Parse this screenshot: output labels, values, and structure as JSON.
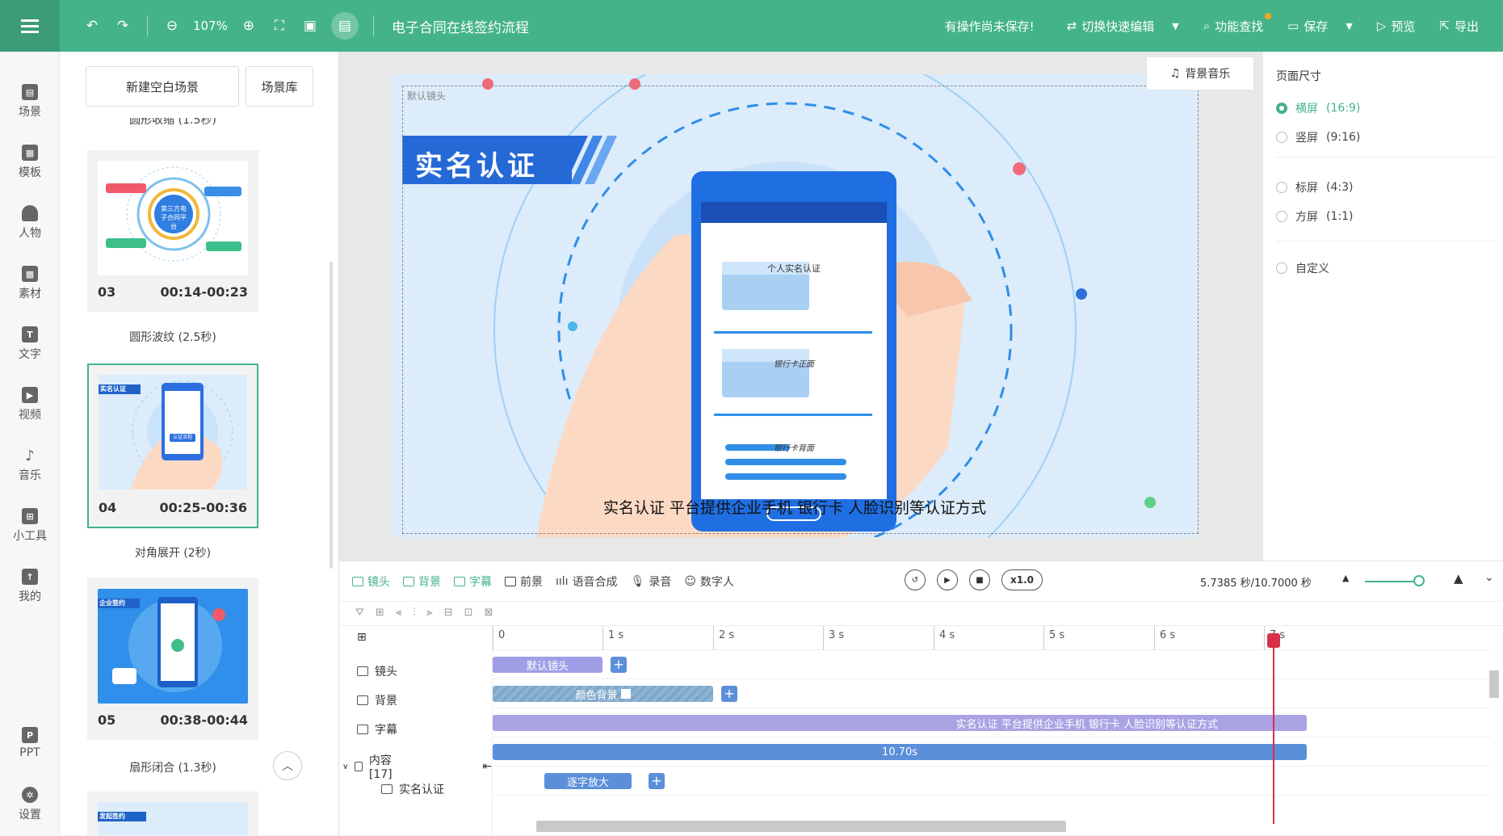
{
  "topbar": {
    "zoom": "107%",
    "doc_title": "电子合同在线签约流程",
    "unsaved": "有操作尚未保存!",
    "switch_label": "切换快速编辑",
    "find_label": "功能查找",
    "save_label": "保存",
    "preview_label": "预览",
    "export_label": "导出"
  },
  "nav": [
    {
      "label": "场景",
      "icon": "scene-icon"
    },
    {
      "label": "模板",
      "icon": "template-icon"
    },
    {
      "label": "人物",
      "icon": "person-icon"
    },
    {
      "label": "素材",
      "icon": "material-icon"
    },
    {
      "label": "文字",
      "icon": "text-icon"
    },
    {
      "label": "视频",
      "icon": "video-icon"
    },
    {
      "label": "音乐",
      "icon": "music-icon"
    },
    {
      "label": "小工具",
      "icon": "toolbox-icon"
    },
    {
      "label": "我的",
      "icon": "upload-icon"
    },
    {
      "label": "PPT",
      "icon": "ppt-icon"
    },
    {
      "label": "设置",
      "icon": "gear-icon"
    }
  ],
  "scenes": {
    "new_blank": "新建空白场景",
    "library": "场景库",
    "top_transition": "圆形收缩 (1.5秒)",
    "cards": [
      {
        "num": "03",
        "time": "00:14-00:23",
        "transition": "圆形波纹 (2.5秒)",
        "hub_label": "第三方电子合同平台"
      },
      {
        "num": "04",
        "time": "00:25-00:36",
        "transition": "对角展开 (2秒)",
        "badge": "实名认证",
        "button": "认证流程"
      },
      {
        "num": "05",
        "time": "00:38-00:44",
        "transition": "扇形闭合 (1.3秒)",
        "badge": "企业签约"
      },
      {
        "badge": "发起签约"
      }
    ]
  },
  "canvas": {
    "camera_label": "默认镜头",
    "bgm_label": "背景音乐",
    "badge_title": "实名认证",
    "phone": {
      "header": "个人实名认证",
      "card_front": "银行卡正面",
      "card_back": "银行卡背面"
    },
    "subtitle": "实名认证  平台提供企业手机 银行卡 人脸识别等认证方式"
  },
  "page_size": {
    "title": "页面尺寸",
    "options": [
      {
        "label": "横屏",
        "ratio": "(16:9)",
        "selected": true
      },
      {
        "label": "竖屏",
        "ratio": "(9:16)",
        "selected": false
      },
      {
        "label": "标屏",
        "ratio": "(4:3)",
        "selected": false
      },
      {
        "label": "方屏",
        "ratio": "(1:1)",
        "selected": false
      },
      {
        "label": "自定义",
        "ratio": "",
        "selected": false
      }
    ]
  },
  "timeline": {
    "tools": [
      "镜头",
      "背景",
      "字幕",
      "前景",
      "语音合成",
      "录音",
      "数字人"
    ],
    "speed": "x1.0",
    "time": "5.7385 秒/10.7000 秒",
    "ruler": [
      "0",
      "1 s",
      "2 s",
      "3 s",
      "4 s",
      "5 s",
      "6 s",
      "7 s"
    ],
    "rows": [
      {
        "label": "镜头",
        "clip": "默认镜头"
      },
      {
        "label": "背景",
        "clip": "颜色背景"
      },
      {
        "label": "字幕",
        "clip": "实名认证  平台提供企业手机 银行卡 人脸识别等认证方式"
      },
      {
        "label": "内容 [17]",
        "clip": "10.70s"
      },
      {
        "label": "实名认证",
        "clip": "逐字放大"
      }
    ]
  },
  "colors": {
    "brand": "#44b389",
    "playhead": "#d9304a"
  }
}
